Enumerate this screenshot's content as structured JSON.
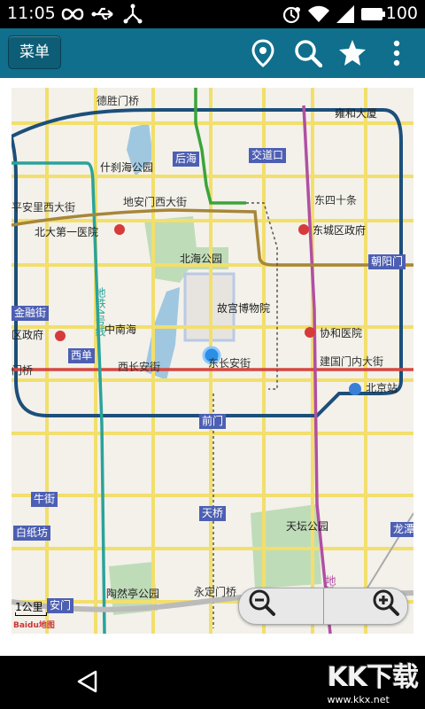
{
  "status_bar": {
    "time": "11:05",
    "battery_percent": "100"
  },
  "app_bar": {
    "menu_label": "菜单",
    "icons": [
      "location-pin-icon",
      "search-icon",
      "star-icon",
      "overflow-menu-icon"
    ]
  },
  "map": {
    "scale_label": "1公里",
    "logo_text": "Baidu地图",
    "pois": [
      {
        "id": "poi-yonghe-temple",
        "label": "雍和大厦"
      },
      {
        "id": "poi-shichahai",
        "label": "什刹海公园"
      },
      {
        "id": "poi-peking-hospital",
        "label": "北大第一医院"
      },
      {
        "id": "poi-beihai",
        "label": "北海公园"
      },
      {
        "id": "poi-dongcheng-gov",
        "label": "东城区政府"
      },
      {
        "id": "poi-palace-museum",
        "label": "故宫博物院"
      },
      {
        "id": "poi-zhongnanhai",
        "label": "中南海"
      },
      {
        "id": "poi-xicheng-gov",
        "label": "区政府"
      },
      {
        "id": "poi-xiehe-hospital",
        "label": "协和医院"
      },
      {
        "id": "poi-beijing-station",
        "label": "北京站"
      },
      {
        "id": "poi-tiantan",
        "label": "天坛公园"
      },
      {
        "id": "poi-taoranting",
        "label": "陶然亭公园"
      }
    ],
    "stations": [
      {
        "id": "st-houhai",
        "label": "后海"
      },
      {
        "id": "st-jiaodaokou",
        "label": "交道口"
      },
      {
        "id": "st-chaoyangmen",
        "label": "朝阳门"
      },
      {
        "id": "st-jinrongjie",
        "label": "金融街"
      },
      {
        "id": "st-xidan",
        "label": "西单"
      },
      {
        "id": "st-qianmen",
        "label": "前门"
      },
      {
        "id": "st-niujie",
        "label": "牛街"
      },
      {
        "id": "st-baizhifang",
        "label": "白纸坊"
      },
      {
        "id": "st-tianqiao",
        "label": "天桥"
      },
      {
        "id": "st-longtan",
        "label": "龙潭"
      },
      {
        "id": "st-taoranting-exit",
        "label": "安门"
      }
    ],
    "roads": [
      {
        "id": "road-deshengmenqiao",
        "label": "德胜门桥"
      },
      {
        "id": "road-pinganli",
        "label": "平安里西大街"
      },
      {
        "id": "road-dianmen",
        "label": "地安门西大街"
      },
      {
        "id": "road-dongsi",
        "label": "东四十条"
      },
      {
        "id": "road-xichangan",
        "label": "西长安街"
      },
      {
        "id": "road-dongchangan",
        "label": "东长安街"
      },
      {
        "id": "road-jianguomen",
        "label": "建国门内大街"
      },
      {
        "id": "road-fuxingmen",
        "label": "门桥"
      },
      {
        "id": "road-yongdingmen",
        "label": "永定门桥"
      },
      {
        "id": "road-metro4",
        "label": "地铁4号线"
      },
      {
        "id": "road-metro5",
        "label": "地铁5号线"
      }
    ],
    "line_colors": {
      "line2": "#1d4f7a",
      "line1": "#d6473f",
      "line4": "#2aa39a",
      "line5": "#b14fa3",
      "line6": "#a7863a",
      "line8": "#3aa43a",
      "station_bg": "#4d5fb3"
    }
  },
  "nav_bar": {
    "watermark_brand": "KK下载",
    "watermark_url": "www.kkx.net"
  }
}
